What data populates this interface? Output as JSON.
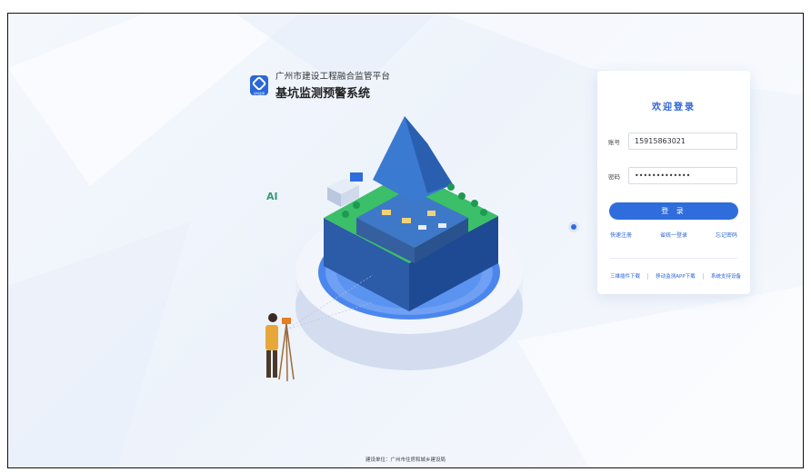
{
  "header": {
    "org_name": "广州市建设工程融合监管平台",
    "system_name": "基坑监测预警系统",
    "logo_caption": "基坑监测",
    "logo_icon": "hexagon-logo-icon"
  },
  "login": {
    "title": "欢迎登录",
    "account_label": "账号",
    "account_value": "15915863021",
    "password_label": "密码",
    "password_value": "•••••••••••••",
    "login_button": "登 录",
    "links": [
      "快速注册",
      "省统一登录",
      "忘记密码"
    ],
    "bottom_links": [
      "三维插件下载",
      "移动监测APP下载",
      "系统支持设备"
    ]
  },
  "footer": {
    "text": "建设单位：广州市住房和城乡建设局"
  },
  "colors": {
    "accent": "#2f6cdc",
    "title": "#2d63d8",
    "background": "#eef3fb"
  }
}
